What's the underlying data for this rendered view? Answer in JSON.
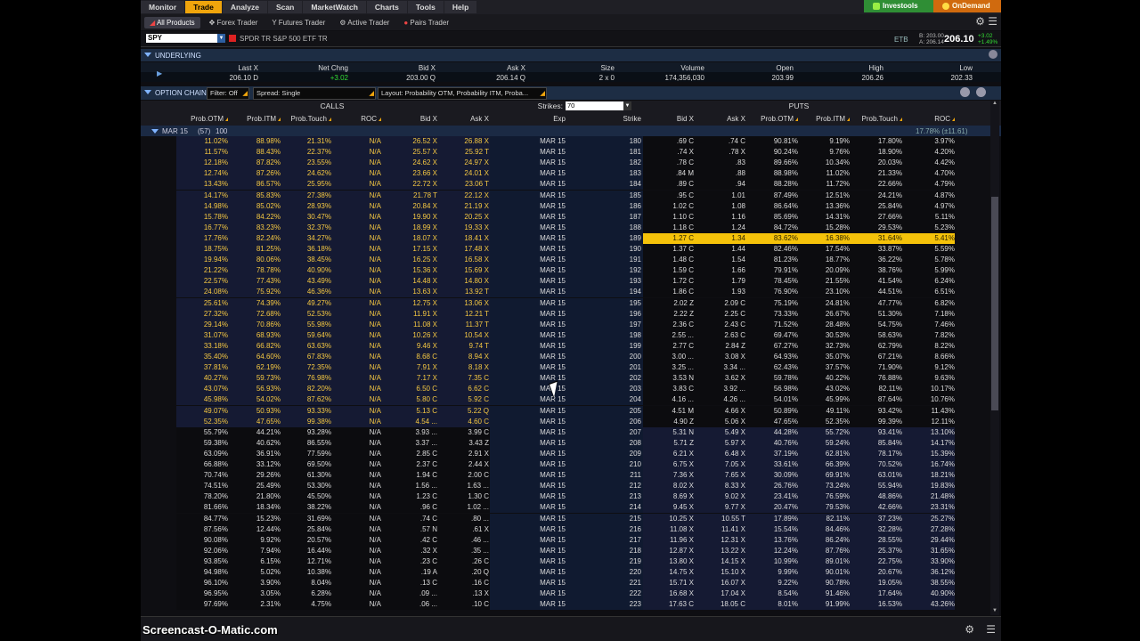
{
  "menu": {
    "tabs": [
      "Monitor",
      "Trade",
      "Analyze",
      "Scan",
      "MarketWatch",
      "Charts",
      "Tools",
      "Help"
    ],
    "active": "Trade",
    "partners": [
      "Investools",
      "OnDemand"
    ]
  },
  "subtabs": {
    "items": [
      "All Products",
      "Forex Trader",
      "Futures Trader",
      "Active Trader",
      "Pairs Trader"
    ],
    "active": "All Products"
  },
  "symbol_bar": {
    "symbol": "SPY",
    "name": "SPDR TR S&P 500 ETF TR",
    "etb": "ETB",
    "bid_line": "B: 203.00",
    "ask_line": "A: 206.14",
    "last": "206.10",
    "net_change": "+3.02",
    "pct_change": "+1.49%"
  },
  "underlying": {
    "title": "UNDERLYING",
    "headers": [
      "Last X",
      "Net Chng",
      "Bid X",
      "Ask X",
      "Size",
      "Volume",
      "Open",
      "High",
      "Low"
    ],
    "values": [
      "206.10 D",
      "+3.02",
      "203.00 Q",
      "206.14 Q",
      "2 x 0",
      "174,356,030",
      "203.99",
      "206.26",
      "202.33"
    ]
  },
  "option_chain": {
    "title": "OPTION CHAIN",
    "filter": "Filter: Off",
    "spread": "Spread: Single",
    "layout": "Layout: Probability OTM, Probability ITM, Proba...",
    "calls_label": "CALLS",
    "puts_label": "PUTS",
    "strikes_label": "Strikes:",
    "strikes_value": "70",
    "call_headers": [
      "Prob.OTM",
      "Prob.ITM",
      "Prob.Touch",
      "ROC",
      "Bid X",
      "Ask X"
    ],
    "center_headers": [
      "Exp",
      "Strike"
    ],
    "put_headers": [
      "Bid X",
      "Ask X",
      "Prob.OTM",
      "Prob.ITM",
      "Prob.Touch",
      "ROC"
    ],
    "expiration": {
      "label": "MAR 15",
      "days": "(57)",
      "count": "100",
      "iv": "17.78% (±11.61)"
    },
    "highlight_strike": "189",
    "rows": [
      [
        "11.02%",
        "88.98%",
        "21.31%",
        "N/A",
        "26.52 X",
        "26.88 X",
        "MAR 15",
        "180",
        ".69 C",
        ".74 C",
        "90.81%",
        "9.19%",
        "17.80%",
        "3.97%"
      ],
      [
        "11.57%",
        "88.43%",
        "22.37%",
        "N/A",
        "25.57 X",
        "25.92 T",
        "MAR 15",
        "181",
        ".74 X",
        ".78 X",
        "90.24%",
        "9.76%",
        "18.90%",
        "4.20%"
      ],
      [
        "12.18%",
        "87.82%",
        "23.55%",
        "N/A",
        "24.62 X",
        "24.97 X",
        "MAR 15",
        "182",
        ".78 C",
        ".83",
        "89.66%",
        "10.34%",
        "20.03%",
        "4.42%"
      ],
      [
        "12.74%",
        "87.26%",
        "24.62%",
        "N/A",
        "23.66 X",
        "24.01 X",
        "MAR 15",
        "183",
        ".84 M",
        ".88",
        "88.98%",
        "11.02%",
        "21.33%",
        "4.70%"
      ],
      [
        "13.43%",
        "86.57%",
        "25.95%",
        "N/A",
        "22.72 X",
        "23.06 T",
        "MAR 15",
        "184",
        ".89 C",
        ".94",
        "88.28%",
        "11.72%",
        "22.66%",
        "4.79%"
      ],
      [
        "14.17%",
        "85.83%",
        "27.38%",
        "N/A",
        "21.78 T",
        "22.12 X",
        "MAR 15",
        "185",
        ".95 C",
        "1.01",
        "87.49%",
        "12.51%",
        "24.21%",
        "4.87%"
      ],
      [
        "14.98%",
        "85.02%",
        "28.93%",
        "N/A",
        "20.84 X",
        "21.19 X",
        "MAR 15",
        "186",
        "1.02 C",
        "1.08",
        "86.64%",
        "13.36%",
        "25.84%",
        "4.97%"
      ],
      [
        "15.78%",
        "84.22%",
        "30.47%",
        "N/A",
        "19.90 X",
        "20.25 X",
        "MAR 15",
        "187",
        "1.10 C",
        "1.16",
        "85.69%",
        "14.31%",
        "27.66%",
        "5.11%"
      ],
      [
        "16.77%",
        "83.23%",
        "32.37%",
        "N/A",
        "18.99 X",
        "19.33 X",
        "MAR 15",
        "188",
        "1.18 C",
        "1.24",
        "84.72%",
        "15.28%",
        "29.53%",
        "5.23%"
      ],
      [
        "17.76%",
        "82.24%",
        "34.27%",
        "N/A",
        "18.07 X",
        "18.41 X",
        "MAR 15",
        "189",
        "1.27 C",
        "1.34",
        "83.62%",
        "16.38%",
        "31.64%",
        "5.41%"
      ],
      [
        "18.75%",
        "81.25%",
        "36.18%",
        "N/A",
        "17.15 X",
        "17.48 X",
        "MAR 15",
        "190",
        "1.37 C",
        "1.44",
        "82.46%",
        "17.54%",
        "33.87%",
        "5.59%"
      ],
      [
        "19.94%",
        "80.06%",
        "38.45%",
        "N/A",
        "16.25 X",
        "16.58 X",
        "MAR 15",
        "191",
        "1.48 C",
        "1.54",
        "81.23%",
        "18.77%",
        "36.22%",
        "5.78%"
      ],
      [
        "21.22%",
        "78.78%",
        "40.90%",
        "N/A",
        "15.36 X",
        "15.69 X",
        "MAR 15",
        "192",
        "1.59 C",
        "1.66",
        "79.91%",
        "20.09%",
        "38.76%",
        "5.99%"
      ],
      [
        "22.57%",
        "77.43%",
        "43.49%",
        "N/A",
        "14.48 X",
        "14.80 X",
        "MAR 15",
        "193",
        "1.72 C",
        "1.79",
        "78.45%",
        "21.55%",
        "41.54%",
        "6.24%"
      ],
      [
        "24.08%",
        "75.92%",
        "46.36%",
        "N/A",
        "13.63 X",
        "13.92 T",
        "MAR 15",
        "194",
        "1.86 C",
        "1.93",
        "76.90%",
        "23.10%",
        "44.51%",
        "6.51%"
      ],
      [
        "25.61%",
        "74.39%",
        "49.27%",
        "N/A",
        "12.75 X",
        "13.06 X",
        "MAR 15",
        "195",
        "2.02 Z",
        "2.09 C",
        "75.19%",
        "24.81%",
        "47.77%",
        "6.82%"
      ],
      [
        "27.32%",
        "72.68%",
        "52.53%",
        "N/A",
        "11.91 X",
        "12.21 T",
        "MAR 15",
        "196",
        "2.22 Z",
        "2.25 C",
        "73.33%",
        "26.67%",
        "51.30%",
        "7.18%"
      ],
      [
        "29.14%",
        "70.86%",
        "55.98%",
        "N/A",
        "11.08 X",
        "11.37 T",
        "MAR 15",
        "197",
        "2.36 C",
        "2.43 C",
        "71.52%",
        "28.48%",
        "54.75%",
        "7.46%"
      ],
      [
        "31.07%",
        "68.93%",
        "59.64%",
        "N/A",
        "10.26 X",
        "10.54 X",
        "MAR 15",
        "198",
        "2.55 ...",
        "2.63 C",
        "69.47%",
        "30.53%",
        "58.63%",
        "7.82%"
      ],
      [
        "33.18%",
        "66.82%",
        "63.63%",
        "N/A",
        "9.46 X",
        "9.74 T",
        "MAR 15",
        "199",
        "2.77 C",
        "2.84 Z",
        "67.27%",
        "32.73%",
        "62.79%",
        "8.22%"
      ],
      [
        "35.40%",
        "64.60%",
        "67.83%",
        "N/A",
        "8.68 C",
        "8.94 X",
        "MAR 15",
        "200",
        "3.00 ...",
        "3.08 X",
        "64.93%",
        "35.07%",
        "67.21%",
        "8.66%"
      ],
      [
        "37.81%",
        "62.19%",
        "72.35%",
        "N/A",
        "7.91 X",
        "8.18 X",
        "MAR 15",
        "201",
        "3.25 ...",
        "3.34 ...",
        "62.43%",
        "37.57%",
        "71.90%",
        "9.12%"
      ],
      [
        "40.27%",
        "59.73%",
        "76.98%",
        "N/A",
        "7.17 X",
        "7.35 C",
        "MAR 15",
        "202",
        "3.53 N",
        "3.62 X",
        "59.78%",
        "40.22%",
        "76.88%",
        "9.63%"
      ],
      [
        "43.07%",
        "56.93%",
        "82.20%",
        "N/A",
        "6.50 C",
        "6.62 C",
        "MAR 15",
        "203",
        "3.83 C",
        "3.92 ...",
        "56.98%",
        "43.02%",
        "82.11%",
        "10.17%"
      ],
      [
        "45.98%",
        "54.02%",
        "87.62%",
        "N/A",
        "5.80 C",
        "5.92 C",
        "MAR 15",
        "204",
        "4.16 ...",
        "4.26 ...",
        "54.01%",
        "45.99%",
        "87.64%",
        "10.76%"
      ],
      [
        "49.07%",
        "50.93%",
        "93.33%",
        "N/A",
        "5.13 C",
        "5.22 Q",
        "MAR 15",
        "205",
        "4.51 M",
        "4.66 X",
        "50.89%",
        "49.11%",
        "93.42%",
        "11.43%"
      ],
      [
        "52.35%",
        "47.65%",
        "99.38%",
        "N/A",
        "4.54 ...",
        "4.60 C",
        "MAR 15",
        "206",
        "4.90 Z",
        "5.06 X",
        "47.65%",
        "52.35%",
        "99.39%",
        "12.11%"
      ],
      [
        "55.79%",
        "44.21%",
        "93.28%",
        "N/A",
        "3.93 ...",
        "3.99 C",
        "MAR 15",
        "207",
        "5.31 N",
        "5.49 X",
        "44.28%",
        "55.72%",
        "93.41%",
        "13.10%"
      ],
      [
        "59.38%",
        "40.62%",
        "86.55%",
        "N/A",
        "3.37 ...",
        "3.43 Z",
        "MAR 15",
        "208",
        "5.71 Z",
        "5.97 X",
        "40.76%",
        "59.24%",
        "85.84%",
        "14.17%"
      ],
      [
        "63.09%",
        "36.91%",
        "77.59%",
        "N/A",
        "2.85 C",
        "2.91 X",
        "MAR 15",
        "209",
        "6.21 X",
        "6.48 X",
        "37.19%",
        "62.81%",
        "78.17%",
        "15.39%"
      ],
      [
        "66.88%",
        "33.12%",
        "69.50%",
        "N/A",
        "2.37 C",
        "2.44 X",
        "MAR 15",
        "210",
        "6.75 X",
        "7.05 X",
        "33.61%",
        "66.39%",
        "70.52%",
        "16.74%"
      ],
      [
        "70.74%",
        "29.26%",
        "61.30%",
        "N/A",
        "1.94 C",
        "2.00 C",
        "MAR 15",
        "211",
        "7.36 X",
        "7.65 X",
        "30.09%",
        "69.91%",
        "63.01%",
        "18.21%"
      ],
      [
        "74.51%",
        "25.49%",
        "53.30%",
        "N/A",
        "1.56 ...",
        "1.63 ...",
        "MAR 15",
        "212",
        "8.02 X",
        "8.33 X",
        "26.76%",
        "73.24%",
        "55.94%",
        "19.83%"
      ],
      [
        "78.20%",
        "21.80%",
        "45.50%",
        "N/A",
        "1.23 C",
        "1.30 C",
        "MAR 15",
        "213",
        "8.69 X",
        "9.02 X",
        "23.41%",
        "76.59%",
        "48.86%",
        "21.48%"
      ],
      [
        "81.66%",
        "18.34%",
        "38.22%",
        "N/A",
        ".96 C",
        "1.02 ...",
        "MAR 15",
        "214",
        "9.45 X",
        "9.77 X",
        "20.47%",
        "79.53%",
        "42.66%",
        "23.31%"
      ],
      [
        "84.77%",
        "15.23%",
        "31.69%",
        "N/A",
        ".74 C",
        ".80 ...",
        "MAR 15",
        "215",
        "10.25 X",
        "10.55 T",
        "17.89%",
        "82.11%",
        "37.23%",
        "25.27%"
      ],
      [
        "87.56%",
        "12.44%",
        "25.84%",
        "N/A",
        ".57 N",
        ".61 X",
        "MAR 15",
        "216",
        "11.08 X",
        "11.41 X",
        "15.54%",
        "84.46%",
        "32.28%",
        "27.28%"
      ],
      [
        "90.08%",
        "9.92%",
        "20.57%",
        "N/A",
        ".42 C",
        ".46 ...",
        "MAR 15",
        "217",
        "11.96 X",
        "12.31 X",
        "13.76%",
        "86.24%",
        "28.55%",
        "29.44%"
      ],
      [
        "92.06%",
        "7.94%",
        "16.44%",
        "N/A",
        ".32 X",
        ".35 ...",
        "MAR 15",
        "218",
        "12.87 X",
        "13.22 X",
        "12.24%",
        "87.76%",
        "25.37%",
        "31.65%"
      ],
      [
        "93.85%",
        "6.15%",
        "12.71%",
        "N/A",
        ".23 C",
        ".26 C",
        "MAR 15",
        "219",
        "13.80 X",
        "14.15 X",
        "10.99%",
        "89.01%",
        "22.75%",
        "33.90%"
      ],
      [
        "94.98%",
        "5.02%",
        "10.38%",
        "N/A",
        ".19 A",
        ".20 Q",
        "MAR 15",
        "220",
        "14.75 X",
        "15.10 X",
        "9.99%",
        "90.01%",
        "20.67%",
        "36.12%"
      ],
      [
        "96.10%",
        "3.90%",
        "8.04%",
        "N/A",
        ".13 C",
        ".16 C",
        "MAR 15",
        "221",
        "15.71 X",
        "16.07 X",
        "9.22%",
        "90.78%",
        "19.05%",
        "38.55%"
      ],
      [
        "96.95%",
        "3.05%",
        "6.28%",
        "N/A",
        ".09 ...",
        ".13 X",
        "MAR 15",
        "222",
        "16.68 X",
        "17.04 X",
        "8.54%",
        "91.46%",
        "17.64%",
        "40.90%"
      ],
      [
        "97.69%",
        "2.31%",
        "4.75%",
        "N/A",
        ".06 ...",
        ".10 C",
        "MAR 15",
        "223",
        "17.63 C",
        "18.05 C",
        "8.01%",
        "91.99%",
        "16.53%",
        "43.26%"
      ]
    ]
  },
  "colors": {
    "accent": "#f0a50c",
    "itm_bg": "#151a33",
    "otm_bg": "#0c0c0f",
    "center_bg": "#101a30",
    "highlight": "#f5c20a",
    "call_itm_text": "#f5c842",
    "positive": "#3d3"
  },
  "watermark": "Screencast-O-Matic.com"
}
